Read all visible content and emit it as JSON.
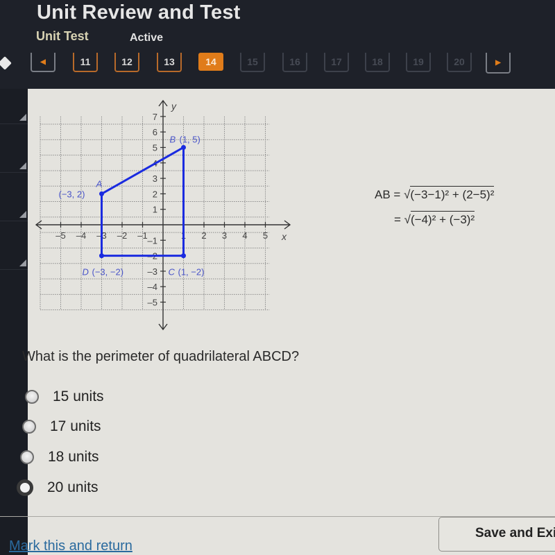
{
  "header": {
    "title": "Unit Review and Test",
    "subtitle": "Unit Test",
    "status": "Active"
  },
  "nav": {
    "prev_icon": "◀",
    "next_icon": "▶",
    "pages": [
      {
        "label": "11",
        "state": "visited"
      },
      {
        "label": "12",
        "state": "visited"
      },
      {
        "label": "13",
        "state": "visited"
      },
      {
        "label": "14",
        "state": "current"
      },
      {
        "label": "15",
        "state": "disabled"
      },
      {
        "label": "16",
        "state": "disabled"
      },
      {
        "label": "17",
        "state": "disabled"
      },
      {
        "label": "18",
        "state": "disabled"
      },
      {
        "label": "19",
        "state": "disabled"
      },
      {
        "label": "20",
        "state": "disabled"
      }
    ]
  },
  "graph": {
    "x_axis_label": "x",
    "y_axis_label": "y",
    "x_ticks": [
      "-5",
      "-4",
      "-3",
      "-2",
      "-1",
      "1",
      "2",
      "3",
      "4",
      "5"
    ],
    "y_ticks": [
      "7",
      "6",
      "5",
      "4",
      "3",
      "2",
      "1",
      "-1",
      "-2",
      "-3",
      "-4",
      "-5"
    ],
    "polygon_color": "#1a2be0",
    "points": [
      {
        "name": "A",
        "coord_label": "(−3, 2)",
        "x": -3,
        "y": 2
      },
      {
        "name": "B",
        "coord_label": "(1, 5)",
        "x": 1,
        "y": 5
      },
      {
        "name": "C",
        "coord_label": "(1, −2)",
        "x": 1,
        "y": -2
      },
      {
        "name": "D",
        "coord_label": "(−3, −2)",
        "x": -3,
        "y": -2
      }
    ]
  },
  "formula": {
    "line1_lhs": "AB = ",
    "line1_rad": "(−3−1)² + (2−5)²",
    "line2_lhs": "= ",
    "line2_rad": "(−4)² + (−3)²"
  },
  "question": {
    "text": "What is the perimeter of quadrilateral ABCD?",
    "options": [
      {
        "label": "15 units",
        "selected": false
      },
      {
        "label": "17 units",
        "selected": false
      },
      {
        "label": "18 units",
        "selected": false
      },
      {
        "label": "20 units",
        "selected": true
      }
    ]
  },
  "footer": {
    "mark_link": "Mark this and return",
    "save_button": "Save and Exit"
  }
}
